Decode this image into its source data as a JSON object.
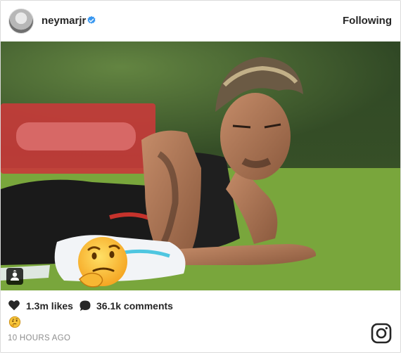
{
  "post": {
    "username": "neymarjr",
    "follow_status": "Following",
    "likes": "1.3m likes",
    "comments": "36.1k comments",
    "time": "10 HOURS AGO"
  },
  "icons": {
    "verified": "verified-badge-icon",
    "heart": "heart-icon",
    "comment": "comment-bubble-icon",
    "user_tag": "user-tag-icon",
    "caption": "thinking-face-emoji",
    "brand": "instagram-logo-icon"
  },
  "colors": {
    "verified_blue": "#3897f0",
    "text": "#262626",
    "muted": "#8e8e8e",
    "border": "#dbdbdb"
  }
}
